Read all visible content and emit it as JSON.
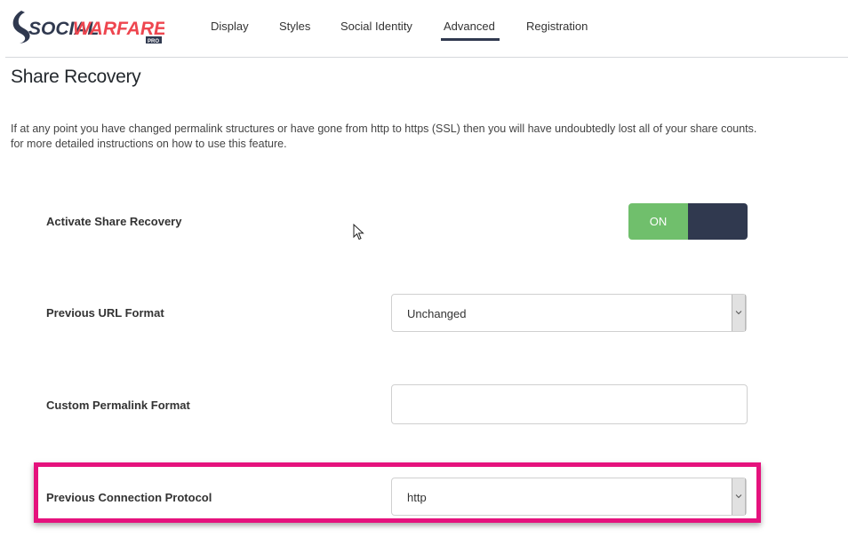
{
  "brand": {
    "logo_text_dark": "SOCIAL",
    "logo_text_accent": "WARFARE",
    "logo_badge": "PRO",
    "colors": {
      "dark": "#30394f",
      "accent": "#ee464f"
    }
  },
  "nav": {
    "tabs": [
      {
        "label": "Display",
        "active": false
      },
      {
        "label": "Styles",
        "active": false
      },
      {
        "label": "Social Identity",
        "active": false
      },
      {
        "label": "Advanced",
        "active": true
      },
      {
        "label": "Registration",
        "active": false
      }
    ]
  },
  "section": {
    "title": "Share Recovery",
    "description_line1": "If at any point you have changed permalink structures or have gone from http to https (SSL) then you will have undoubtedly lost all of your share counts.",
    "description_line2": "for more detailed instructions on how to use this feature."
  },
  "settings": {
    "activate": {
      "label": "Activate Share Recovery",
      "toggle_label": "ON",
      "state": "on",
      "on_color": "#70bf6c",
      "off_color": "#30394f"
    },
    "previous_url_format": {
      "label": "Previous URL Format",
      "selected": "Unchanged"
    },
    "custom_permalink": {
      "label": "Custom Permalink Format",
      "value": ""
    },
    "previous_protocol": {
      "label": "Previous Connection Protocol",
      "selected": "http",
      "highlight_color": "#e5127d"
    }
  }
}
